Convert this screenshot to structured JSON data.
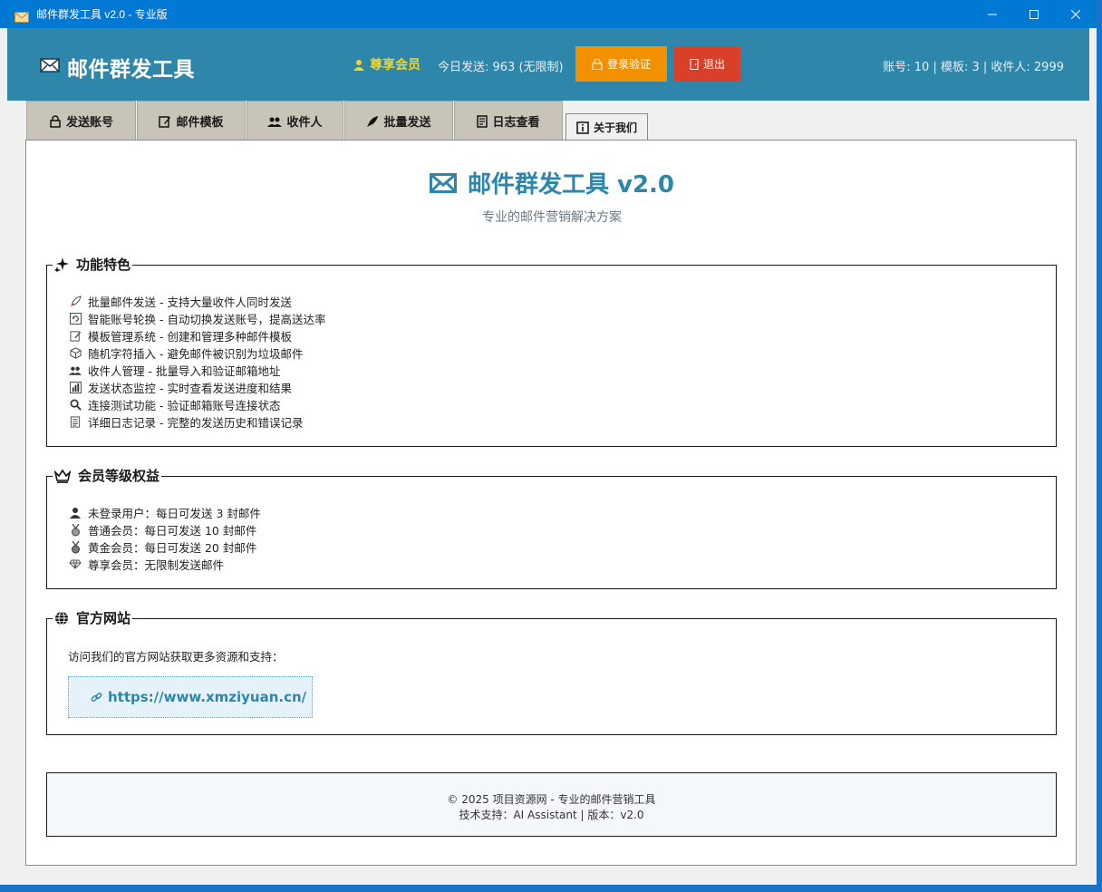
{
  "window": {
    "title": "邮件群发工具 v2.0 - 专业版",
    "controls": {
      "minimize_icon": "minimize-icon",
      "maximize_icon": "maximize-icon",
      "close_icon": "close-icon"
    }
  },
  "header": {
    "brand": "邮件群发工具",
    "member_label": "尊享会员",
    "today_sent": "今日发送: 963 (无限制)",
    "login_button": "登录验证",
    "logout_button": "退出",
    "stats": "账号: 10 | 模板: 3 | 收件人: 2999"
  },
  "tabs": [
    {
      "label": "发送账号",
      "icon": "lock-icon"
    },
    {
      "label": "邮件模板",
      "icon": "edit-icon"
    },
    {
      "label": "收件人",
      "icon": "users-icon"
    },
    {
      "label": "批量发送",
      "icon": "rocket-icon"
    },
    {
      "label": "日志查看",
      "icon": "log-icon"
    },
    {
      "label": "关于我们",
      "icon": "info-icon",
      "active": true
    }
  ],
  "about": {
    "title": "邮件群发工具 v2.0",
    "subtitle": "专业的邮件营销解决方案",
    "features": {
      "heading": "功能特色",
      "items": [
        "批量邮件发送 - 支持大量收件人同时发送",
        "智能账号轮换 - 自动切换发送账号，提高送达率",
        "模板管理系统 - 创建和管理多种邮件模板",
        "随机字符插入 - 避免邮件被识别为垃圾邮件",
        "收件人管理 - 批量导入和验证邮箱地址",
        "发送状态监控 - 实时查看发送进度和结果",
        "连接测试功能 - 验证邮箱账号连接状态",
        "详细日志记录 - 完整的发送历史和错误记录"
      ]
    },
    "levels": {
      "heading": "会员等级权益",
      "items": [
        "未登录用户：每日可发送 3 封邮件",
        "普通会员：每日可发送 10 封邮件",
        "黄金会员：每日可发送 20 封邮件",
        "尊享会员：无限制发送邮件"
      ]
    },
    "site": {
      "heading": "官方网站",
      "desc": "访问我们的官方网站获取更多资源和支持：",
      "url": "https://www.xmziyuan.cn/"
    },
    "footer": {
      "line1": "© 2025 项目资源网 - 专业的邮件营销工具",
      "line2": "技术支持：AI Assistant | 版本：v2.0"
    }
  },
  "colors": {
    "header": "#2e86ab",
    "titlebar": "#0078d4",
    "login": "#f29100",
    "logout": "#d8402a",
    "accent": "#2e86ab"
  }
}
